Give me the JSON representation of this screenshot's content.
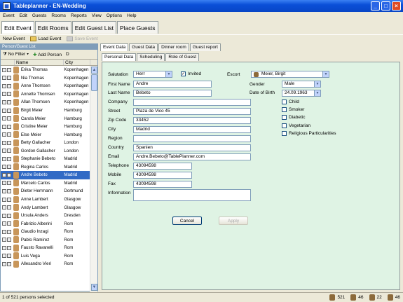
{
  "window": {
    "title": "Tableplanner - EN-Wedding"
  },
  "menu": [
    "Event",
    "Edit",
    "Guests",
    "Rooms",
    "Reports",
    "View",
    "Options",
    "Help"
  ],
  "main_tabs": [
    "Edit Event",
    "Edit Rooms",
    "Edit Guest List",
    "Place Guests"
  ],
  "toolbar": {
    "new_event": "New Event",
    "load_event": "Load Event",
    "save_event": "Save Event"
  },
  "left": {
    "header": "Person/Guest List",
    "filter": "No Filter",
    "add_person": "Add Person",
    "extra_btn": "D",
    "col_name": "Name",
    "col_city": "City",
    "rows": [
      {
        "name": "Erika Thomas",
        "city": "Kopenhagen"
      },
      {
        "name": "Nia Thomas",
        "city": "Kopenhagen"
      },
      {
        "name": "Anne Thomsen",
        "city": "Kopenhagen"
      },
      {
        "name": "Annette Thomsen",
        "city": "Kopenhagen"
      },
      {
        "name": "Allan Thomsen",
        "city": "Kopenhagen"
      },
      {
        "name": "Birgit Meier",
        "city": "Hamburg"
      },
      {
        "name": "Carola Meier",
        "city": "Hamburg"
      },
      {
        "name": "Cristine Meier",
        "city": "Hamburg"
      },
      {
        "name": "Else Meier",
        "city": "Hamburg"
      },
      {
        "name": "Betty Gallacher",
        "city": "London"
      },
      {
        "name": "Gordon Gallacher",
        "city": "London"
      },
      {
        "name": "Stephanie Bebeto",
        "city": "Madrid"
      },
      {
        "name": "Regina Carlos",
        "city": "Madrid"
      },
      {
        "name": "Andre Bebeto",
        "city": "Madrid"
      },
      {
        "name": "Marcelo Carlos",
        "city": "Madrid"
      },
      {
        "name": "Dieter Herrmann",
        "city": "Dortmund"
      },
      {
        "name": "Anne Lambert",
        "city": "Glasgow"
      },
      {
        "name": "Andy Lambert",
        "city": "Glasgow"
      },
      {
        "name": "Ursula Anders",
        "city": "Dresden"
      },
      {
        "name": "Fabrizio Alberini",
        "city": "Rom"
      },
      {
        "name": "Claudio Inzagi",
        "city": "Rom"
      },
      {
        "name": "Pablo Ramirez",
        "city": "Rom"
      },
      {
        "name": "Fausto Ravanelli",
        "city": "Rom"
      },
      {
        "name": "Luis Vega",
        "city": "Rom"
      },
      {
        "name": "Allesandro Vieri",
        "city": "Rom"
      }
    ],
    "selected_index": 13
  },
  "status": {
    "text": "1 of 521 persons selected",
    "count1": "521",
    "count2": "46",
    "count3": "22",
    "count4": "46"
  },
  "right": {
    "tabs": [
      "Event Data",
      "Guest Data",
      "Dinner room",
      "Guest report"
    ],
    "subtabs": [
      "Personal Data",
      "Scheduling",
      "Role of Guest"
    ],
    "labels": {
      "salutation": "Salutation",
      "invited": "Invited",
      "escort": "Escort",
      "first_name": "First Name",
      "last_name": "Last Name",
      "gender": "Gender",
      "dob": "Date of Birth",
      "company": "Company",
      "street": "Street",
      "zip": "Zip Code",
      "city": "City",
      "region": "Region",
      "country": "Country",
      "email": "Email",
      "telephone": "Telephone",
      "mobile": "Mobile",
      "fax": "Fax",
      "information": "Information"
    },
    "values": {
      "salutation": "Herr",
      "escort": "Meier, Birgit",
      "first_name": "Andre",
      "last_name": "Bebeto",
      "gender": "Male",
      "dob": "24.09.1963",
      "company": "",
      "street": "Plaza de Vico 45",
      "zip": "33452",
      "city": "Madrid",
      "region": "",
      "country": "Spanien",
      "email": "Andre.Bebeto@TablePlanner.com",
      "telephone": "43094598",
      "mobile": "43094598",
      "fax": "43094598",
      "information": ""
    },
    "checkboxes": [
      "Child",
      "Smoker",
      "Diabetic",
      "Vegetarian",
      "Religious Particularities"
    ],
    "cancel": "Cancel",
    "apply": "Apply"
  }
}
